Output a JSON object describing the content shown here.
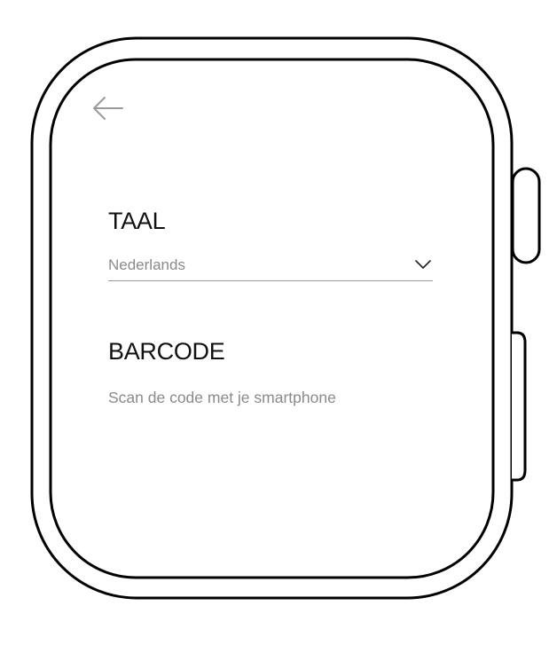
{
  "screen": {
    "back_icon": "arrow-left-icon",
    "language": {
      "title": "TAAL",
      "selected": "Nederlands",
      "dropdown_icon": "chevron-down-icon"
    },
    "barcode": {
      "title": "BARCODE",
      "description": "Scan de code met je smartphone"
    }
  },
  "colors": {
    "frame_stroke": "#000000",
    "title_text": "#111111",
    "secondary_text": "#8a8a8a",
    "divider": "#9a9a9a",
    "background": "#ffffff"
  }
}
